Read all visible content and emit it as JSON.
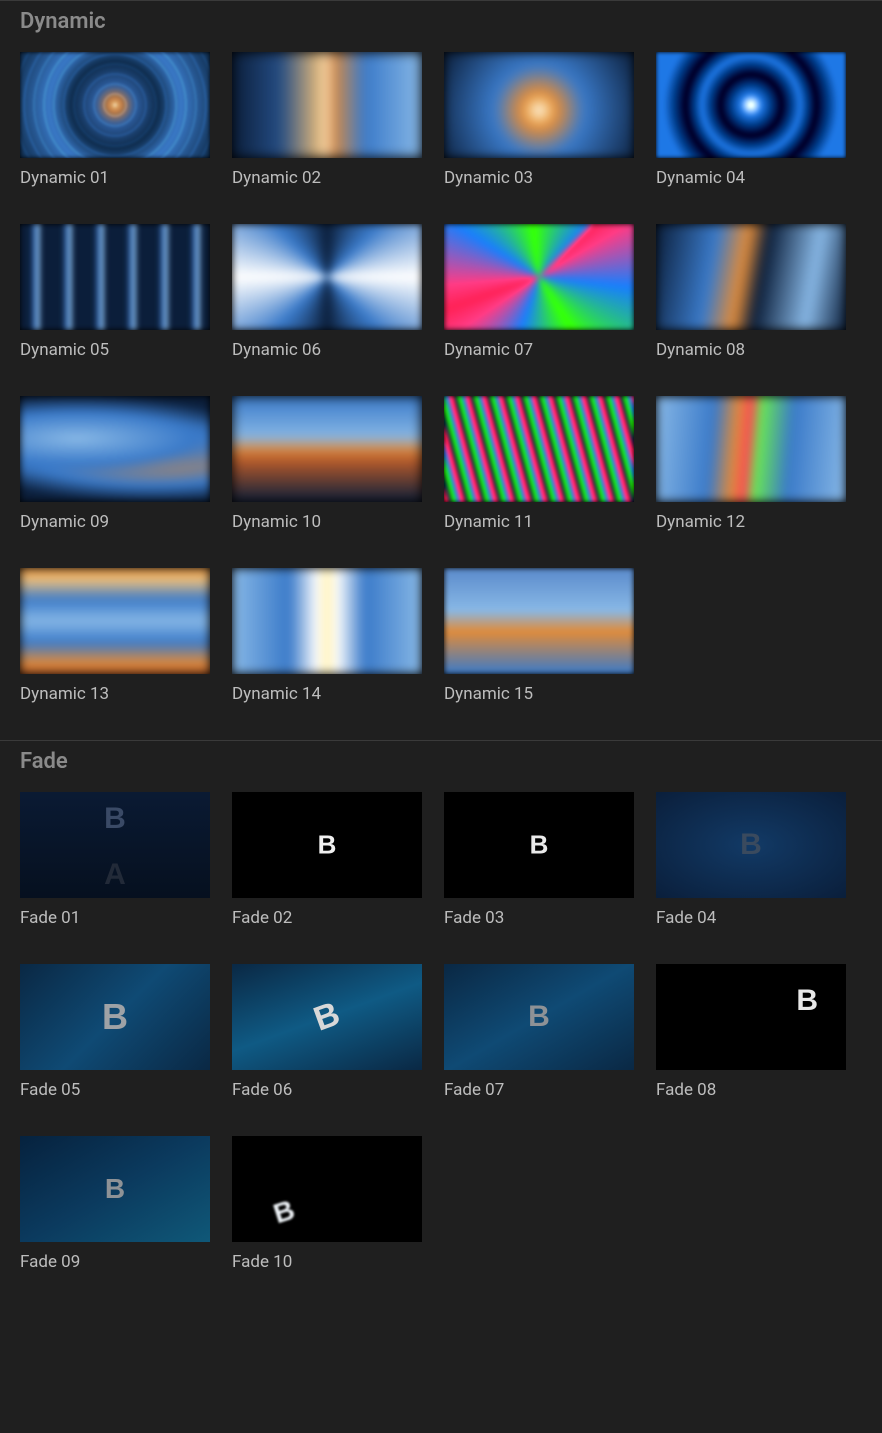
{
  "sections": {
    "dynamic": {
      "title": "Dynamic",
      "items": [
        {
          "label": "Dynamic 01"
        },
        {
          "label": "Dynamic 02"
        },
        {
          "label": "Dynamic 03"
        },
        {
          "label": "Dynamic 04"
        },
        {
          "label": "Dynamic 05"
        },
        {
          "label": "Dynamic 06"
        },
        {
          "label": "Dynamic 07"
        },
        {
          "label": "Dynamic 08"
        },
        {
          "label": "Dynamic 09"
        },
        {
          "label": "Dynamic 10"
        },
        {
          "label": "Dynamic 11"
        },
        {
          "label": "Dynamic 12"
        },
        {
          "label": "Dynamic 13"
        },
        {
          "label": "Dynamic 14"
        },
        {
          "label": "Dynamic 15"
        }
      ]
    },
    "fade": {
      "title": "Fade",
      "items": [
        {
          "label": "Fade 01",
          "overlay_b": "B",
          "overlay_a": "A"
        },
        {
          "label": "Fade 02",
          "overlay_b": "B"
        },
        {
          "label": "Fade 03",
          "overlay_b": "B"
        },
        {
          "label": "Fade 04",
          "overlay_b": "B"
        },
        {
          "label": "Fade 05",
          "overlay_b": "B"
        },
        {
          "label": "Fade 06",
          "overlay_b": "B"
        },
        {
          "label": "Fade 07",
          "overlay_b": "B"
        },
        {
          "label": "Fade 08",
          "overlay_b": "B"
        },
        {
          "label": "Fade 09",
          "overlay_b": "B"
        },
        {
          "label": "Fade 10",
          "overlay_b": "B"
        }
      ]
    }
  }
}
